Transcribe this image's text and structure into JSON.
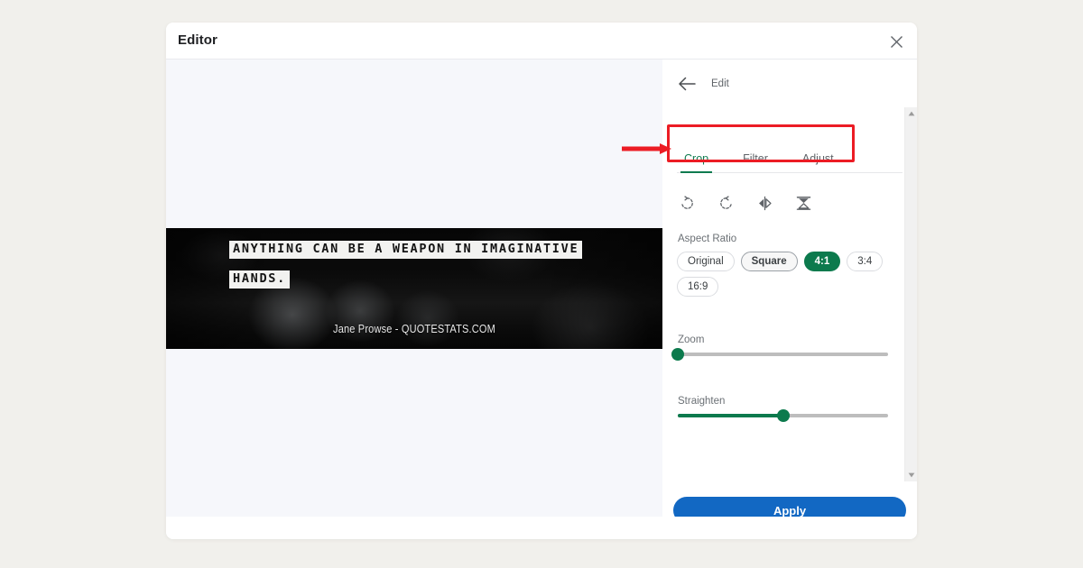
{
  "window": {
    "title": "Editor",
    "close_icon": "close-icon"
  },
  "canvas": {
    "image": {
      "quote_line_1": "ANYTHING CAN BE A WEAPON IN IMAGINATIVE",
      "quote_line_2": "HANDS.",
      "attribution": "Jane Prowse - QUOTESTATS.COM",
      "alt": "dark photo of wine glasses on a bar with white quote text"
    },
    "background_color": "#f6f7fb"
  },
  "panel": {
    "back_icon": "arrow-left-icon",
    "heading": "Edit",
    "tabs": [
      {
        "label": "Crop",
        "active": true
      },
      {
        "label": "Filter",
        "active": false
      },
      {
        "label": "Adjust",
        "active": false
      }
    ],
    "tools": [
      {
        "name": "rotate-right-icon",
        "label": "Rotate right"
      },
      {
        "name": "rotate-left-icon",
        "label": "Rotate left"
      },
      {
        "name": "flip-horizontal-icon",
        "label": "Flip horizontal"
      },
      {
        "name": "flip-vertical-icon",
        "label": "Flip vertical"
      }
    ],
    "aspect_ratio": {
      "label": "Aspect Ratio",
      "options": [
        {
          "label": "Original",
          "state": "default"
        },
        {
          "label": "Square",
          "state": "hover"
        },
        {
          "label": "4:1",
          "state": "active"
        },
        {
          "label": "3:4",
          "state": "default"
        },
        {
          "label": "16:9",
          "state": "default"
        }
      ]
    },
    "zoom": {
      "label": "Zoom",
      "value_percent": 0
    },
    "straighten": {
      "label": "Straighten",
      "value_percent": 50
    },
    "apply_button": "Apply",
    "scrollbar": {
      "up_icon": "scroll-up-arrow-icon",
      "down_icon": "scroll-down-arrow-icon"
    }
  },
  "annotation": {
    "color": "#ec1c24",
    "highlight_target": "Crop / Filter / Adjust tab bar",
    "arrow_icon": "red-pointer-arrow-icon"
  },
  "theme": {
    "page_background": "#f1f0ec",
    "accent_green": "#0c7a4d",
    "accent_blue": "#1268c3",
    "annotation_red": "#ec1c24"
  }
}
